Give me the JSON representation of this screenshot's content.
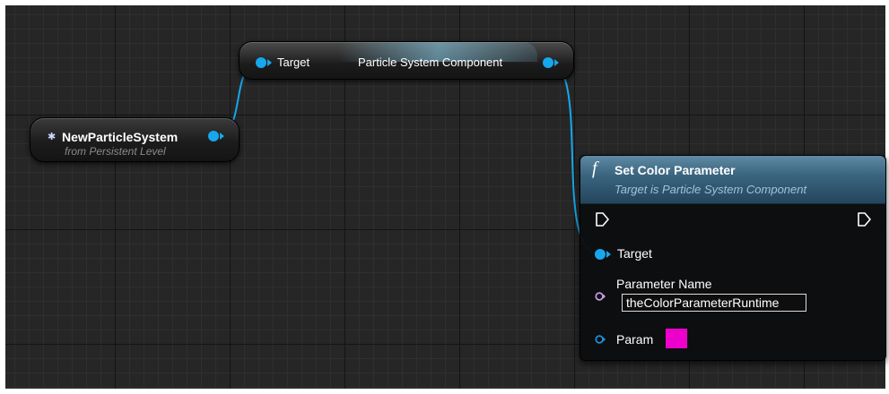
{
  "variable_node": {
    "name": "NewParticleSystem",
    "subtitle": "from Persistent Level",
    "pin_color": "#17a7ec"
  },
  "getter_node": {
    "input_label": "Target",
    "output_label": "Particle System Component"
  },
  "function_node": {
    "icon": "function-f-icon",
    "title": "Set Color Parameter",
    "subtitle": "Target is Particle System Component",
    "header_color": "#3b6580",
    "target_label": "Target",
    "parameter_name_label": "Parameter Name",
    "parameter_name_value": "theColorParameterRuntime",
    "param_label": "Param",
    "param_color": "#ee00cc",
    "name_pin_color": "#c79be6",
    "param_pin_color": "#1e90d8"
  }
}
